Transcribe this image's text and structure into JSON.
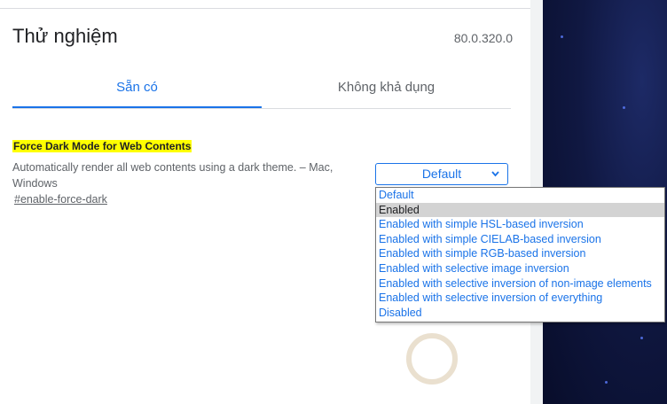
{
  "header": {
    "title": "Thử nghiệm",
    "version": "80.0.320.0"
  },
  "tabs": [
    {
      "label": "Sẵn có",
      "active": true
    },
    {
      "label": "Không khả dụng",
      "active": false
    }
  ],
  "flag": {
    "title": "Force Dark Mode for Web Contents",
    "description": "Automatically render all web contents using a dark theme. – Mac, Windows",
    "link": "#enable-force-dark",
    "select_value": "Default",
    "options": [
      "Default",
      "Enabled",
      "Enabled with simple HSL-based inversion",
      "Enabled with simple CIELAB-based inversion",
      "Enabled with simple RGB-based inversion",
      "Enabled with selective image inversion",
      "Enabled with selective inversion of non-image elements",
      "Enabled with selective inversion of everything",
      "Disabled"
    ],
    "highlighted_option": "Enabled"
  },
  "colors": {
    "accent": "#1a73e8",
    "highlight": "#ffff00",
    "dark_background": "#101842"
  },
  "icons": {
    "select_arrow": "chevron-down-icon"
  }
}
